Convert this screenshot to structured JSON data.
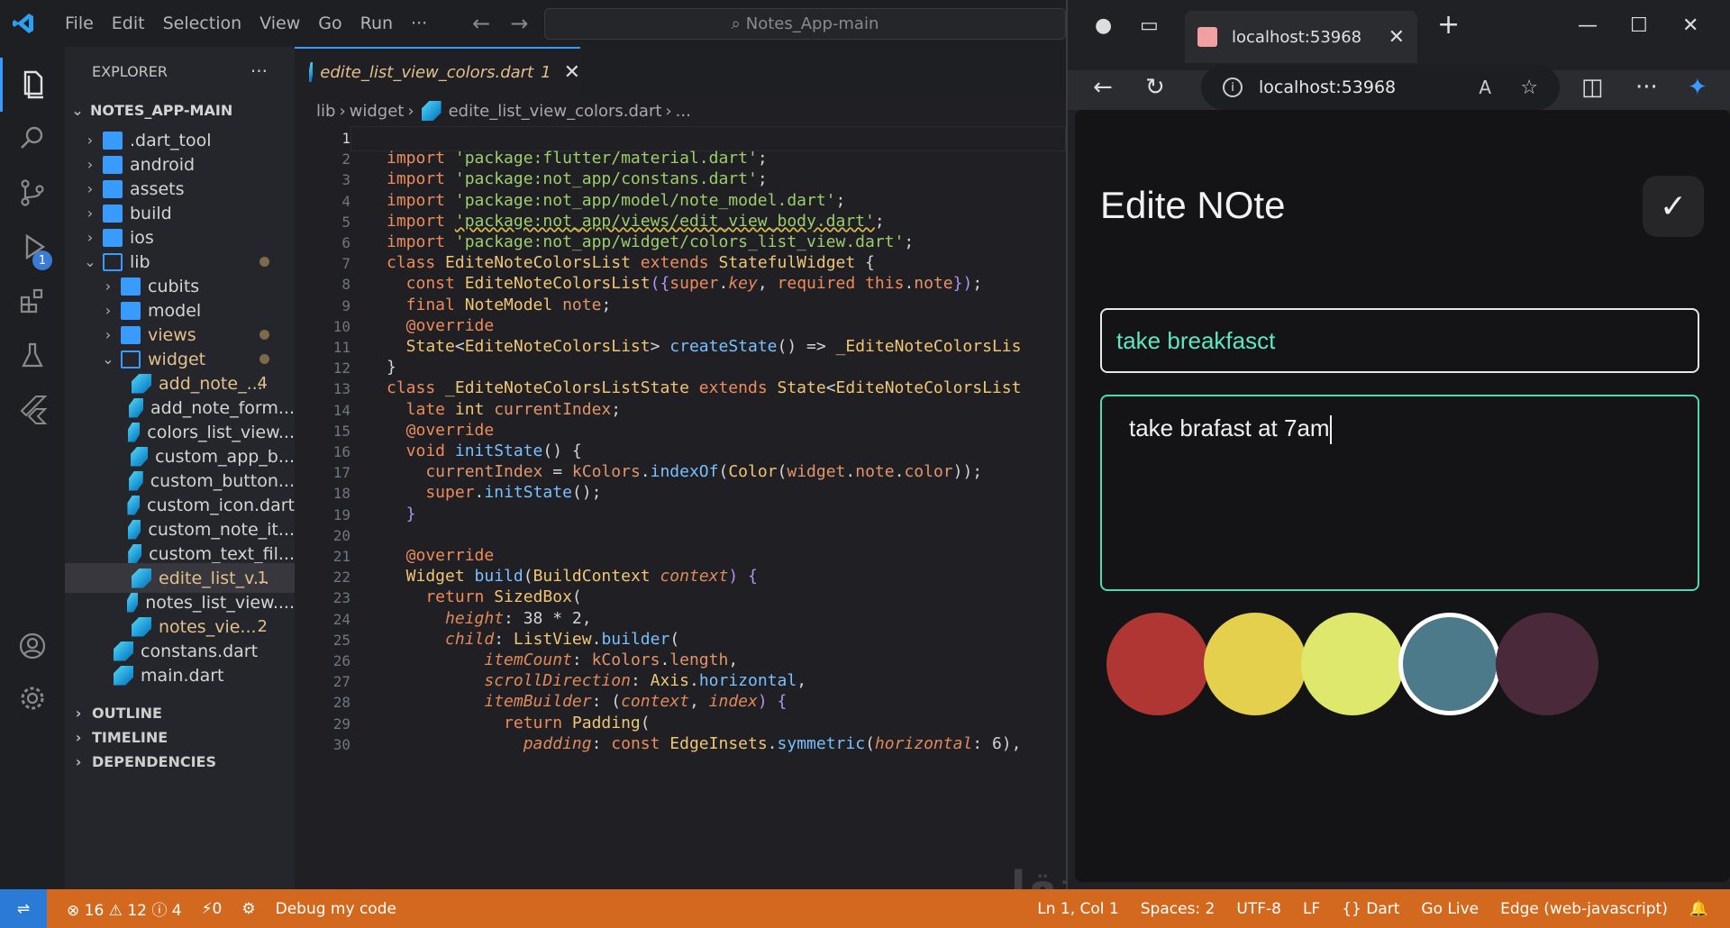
{
  "titlebar": {
    "menu": [
      "File",
      "Edit",
      "Selection",
      "View",
      "Go",
      "Run",
      "···"
    ],
    "search": "Notes_App-main"
  },
  "activity": {
    "debug_badge": "1"
  },
  "explorer": {
    "title": "EXPLORER",
    "more": "···",
    "root": "NOTES_APP-MAIN",
    "items": [
      {
        "label": ".dart_tool",
        "kind": "folder",
        "depth": 1
      },
      {
        "label": "android",
        "kind": "folder",
        "depth": 1
      },
      {
        "label": "assets",
        "kind": "folder",
        "depth": 1
      },
      {
        "label": "build",
        "kind": "folder",
        "depth": 1
      },
      {
        "label": "ios",
        "kind": "folder",
        "depth": 1
      },
      {
        "label": "lib",
        "kind": "folder-open",
        "depth": 1,
        "mark": "dot"
      },
      {
        "label": "cubits",
        "kind": "folder",
        "depth": 2
      },
      {
        "label": "model",
        "kind": "folder",
        "depth": 2
      },
      {
        "label": "views",
        "kind": "folder",
        "depth": 2,
        "mark": "dot",
        "color": "#e2c08d"
      },
      {
        "label": "widget",
        "kind": "folder-open",
        "depth": 2,
        "mark": "dot",
        "color": "#e2c08d"
      },
      {
        "label": "add_note_...",
        "kind": "dart",
        "depth": 3,
        "mark": "4",
        "color": "#e2c08d"
      },
      {
        "label": "add_note_form...",
        "kind": "dart",
        "depth": 3
      },
      {
        "label": "colors_list_view...",
        "kind": "dart",
        "depth": 3
      },
      {
        "label": "custom_app_b...",
        "kind": "dart",
        "depth": 3
      },
      {
        "label": "custom_button...",
        "kind": "dart",
        "depth": 3
      },
      {
        "label": "custom_icon.dart",
        "kind": "dart",
        "depth": 3
      },
      {
        "label": "custom_note_it...",
        "kind": "dart",
        "depth": 3
      },
      {
        "label": "custom_text_fil...",
        "kind": "dart",
        "depth": 3
      },
      {
        "label": "edite_list_v...",
        "kind": "dart",
        "depth": 3,
        "mark": "1",
        "color": "#e2c08d",
        "selected": true
      },
      {
        "label": "notes_list_view....",
        "kind": "dart",
        "depth": 3
      },
      {
        "label": "notes_vie...",
        "kind": "dart",
        "depth": 3,
        "mark": "2",
        "color": "#e2c08d"
      },
      {
        "label": "constans.dart",
        "kind": "dart",
        "depth": 2
      },
      {
        "label": "main.dart",
        "kind": "dart",
        "depth": 2
      }
    ],
    "sections": [
      "OUTLINE",
      "TIMELINE",
      "DEPENDENCIES"
    ]
  },
  "editor": {
    "tab_label": "edite_list_view_colors.dart",
    "tab_badge": "1",
    "breadcrumb": [
      "lib",
      "widget",
      "edite_list_view_colors.dart",
      "..."
    ],
    "lines": [
      [],
      [
        [
          "import ",
          "k"
        ],
        [
          "'package:flutter/material.dart'",
          "s"
        ],
        [
          ";",
          ""
        ]
      ],
      [
        [
          "import ",
          "k"
        ],
        [
          "'package:not_app/constans.dart'",
          "s"
        ],
        [
          ";",
          ""
        ]
      ],
      [
        [
          "import ",
          "k"
        ],
        [
          "'package:not_app/model/note_model.dart'",
          "s"
        ],
        [
          ";",
          ""
        ]
      ],
      [
        [
          "import ",
          "k"
        ],
        [
          "'package:not_app/views/edit_view_body.dart'",
          "s"
        ],
        [
          ";",
          ""
        ]
      ],
      [
        [
          "import ",
          "k"
        ],
        [
          "'package:not_app/widget/colors_list_view.dart'",
          "s"
        ],
        [
          ";",
          ""
        ]
      ],
      [
        [
          "class ",
          "k"
        ],
        [
          "EditeNoteColorsList ",
          "t"
        ],
        [
          "extends ",
          "k"
        ],
        [
          "StatefulWidget ",
          "t"
        ],
        [
          "{",
          ""
        ]
      ],
      [
        [
          "  const ",
          "k"
        ],
        [
          "EditeNoteColorsList",
          "t"
        ],
        [
          "({",
          "p"
        ],
        [
          "super",
          "k"
        ],
        [
          ".",
          ""
        ],
        [
          "key",
          "i"
        ],
        [
          ", ",
          ""
        ],
        [
          "required ",
          "k"
        ],
        [
          "this",
          "k"
        ],
        [
          ".",
          ""
        ],
        [
          "note",
          "v"
        ],
        [
          "})",
          "p"
        ],
        [
          ";",
          ""
        ]
      ],
      [
        [
          "  final ",
          "k"
        ],
        [
          "NoteModel ",
          "t"
        ],
        [
          "note",
          "v"
        ],
        [
          ";",
          ""
        ]
      ],
      [
        [
          "  @override",
          "k"
        ]
      ],
      [
        [
          "  State",
          "t"
        ],
        [
          "<",
          ""
        ],
        [
          "EditeNoteColorsList",
          "t"
        ],
        [
          "> ",
          ""
        ],
        [
          "createState",
          "f"
        ],
        [
          "() => ",
          ""
        ],
        [
          "_EditeNoteColorsLis",
          "t"
        ]
      ],
      [
        [
          "}",
          ""
        ]
      ],
      [
        [
          "class ",
          "k"
        ],
        [
          "_EditeNoteColorsListState ",
          "t"
        ],
        [
          "extends ",
          "k"
        ],
        [
          "State",
          "t"
        ],
        [
          "<",
          ""
        ],
        [
          "EditeNoteColorsList",
          "t"
        ]
      ],
      [
        [
          "  late ",
          "k"
        ],
        [
          "int ",
          "t"
        ],
        [
          "currentIndex",
          "v"
        ],
        [
          ";",
          ""
        ]
      ],
      [
        [
          "  @override",
          "k"
        ]
      ],
      [
        [
          "  void ",
          "k"
        ],
        [
          "initState",
          "f"
        ],
        [
          "() {",
          ""
        ]
      ],
      [
        [
          "    currentIndex ",
          "v"
        ],
        [
          "= ",
          ""
        ],
        [
          "kColors",
          "v"
        ],
        [
          ".",
          ""
        ],
        [
          "indexOf",
          "f"
        ],
        [
          "(",
          ""
        ],
        [
          "Color",
          "t"
        ],
        [
          "(",
          ""
        ],
        [
          "widget",
          "v"
        ],
        [
          ".",
          ""
        ],
        [
          "note",
          "v"
        ],
        [
          ".",
          ""
        ],
        [
          "color",
          "v"
        ],
        [
          "));",
          ""
        ]
      ],
      [
        [
          "    super",
          "k"
        ],
        [
          ".",
          ""
        ],
        [
          "initState",
          "f"
        ],
        [
          "();",
          ""
        ]
      ],
      [
        [
          "  }",
          "p"
        ]
      ],
      [],
      [
        [
          "  @override",
          "k"
        ]
      ],
      [
        [
          "  Widget ",
          "t"
        ],
        [
          "build",
          "f"
        ],
        [
          "(",
          ""
        ],
        [
          "BuildContext ",
          "t"
        ],
        [
          "context",
          "i"
        ],
        [
          ") {",
          "p"
        ]
      ],
      [
        [
          "    return ",
          "k"
        ],
        [
          "SizedBox",
          "t"
        ],
        [
          "(",
          ""
        ]
      ],
      [
        [
          "      height",
          "i"
        ],
        [
          ": 38 * 2,",
          ""
        ]
      ],
      [
        [
          "      child",
          "i"
        ],
        [
          ": ",
          ""
        ],
        [
          "ListView",
          "t"
        ],
        [
          ".",
          ""
        ],
        [
          "builder",
          "f"
        ],
        [
          "(",
          ""
        ]
      ],
      [
        [
          "          itemCount",
          "i"
        ],
        [
          ": ",
          ""
        ],
        [
          "kColors",
          "v"
        ],
        [
          ".",
          ""
        ],
        [
          "length",
          "v"
        ],
        [
          ",",
          ""
        ]
      ],
      [
        [
          "          scrollDirection",
          "i"
        ],
        [
          ": ",
          ""
        ],
        [
          "Axis",
          "t"
        ],
        [
          ".",
          ""
        ],
        [
          "horizontal",
          "f"
        ],
        [
          ",",
          ""
        ]
      ],
      [
        [
          "          itemBuilder",
          "i"
        ],
        [
          ": (",
          ""
        ],
        [
          "context",
          "i"
        ],
        [
          ", ",
          ""
        ],
        [
          "index",
          "i"
        ],
        [
          ") {",
          "p"
        ]
      ],
      [
        [
          "            return ",
          "k"
        ],
        [
          "Padding",
          "t"
        ],
        [
          "(",
          ""
        ]
      ],
      [
        [
          "              padding",
          "i"
        ],
        [
          ": ",
          ""
        ],
        [
          "const ",
          "k"
        ],
        [
          "EdgeInsets",
          "t"
        ],
        [
          ".",
          ""
        ],
        [
          "symmetric",
          "f"
        ],
        [
          "(",
          ""
        ],
        [
          "horizontal",
          "i"
        ],
        [
          ": 6),",
          ""
        ]
      ]
    ]
  },
  "watermark": "مستقل mostaql.com",
  "statusbar": {
    "errors": "⊗ 16 ⚠ 12 ⓘ 4",
    "ports": "⚡0",
    "debug": "Debug my code",
    "position": "Ln 1, Col 1",
    "spaces": "Spaces: 2",
    "encoding": "UTF-8",
    "eol": "LF",
    "language": "{} Dart",
    "golive": "Go Live",
    "target": "Edge (web-javascript)"
  },
  "browser": {
    "tab_title": "localhost:53968",
    "url": "localhost:53968",
    "app": {
      "title": "Edite NOte",
      "title_field": "take breakfasct",
      "content_field": "take brafast at 7am",
      "colors": [
        "#b03634",
        "#e5d04e",
        "#dde86c",
        "#4d7a8b",
        "#4a2a3a"
      ],
      "selected_color_index": 3
    }
  }
}
